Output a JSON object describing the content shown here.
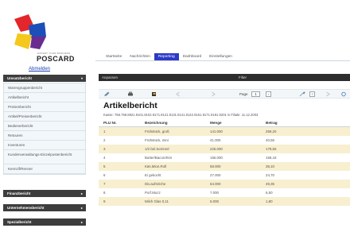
{
  "app": {
    "brand": "POSCARD",
    "tagline": "EXPERT YOUR BUSINESS",
    "logout": "Abmelden"
  },
  "colors": {
    "accent": "#2c3ac7",
    "sidebar_header": "#3d3d3d",
    "row_highlight": "#f7efcf",
    "logo_red": "#e3262b",
    "logo_blue": "#1d4fb8",
    "logo_yellow": "#f4c81c",
    "logo_purple": "#6a2c91"
  },
  "sidebar": {
    "sections": [
      {
        "label": "Umsatzbericht",
        "expanded": true
      },
      {
        "label": "Finanzbericht",
        "expanded": false
      },
      {
        "label": "Unternehmensbericht",
        "expanded": false
      },
      {
        "label": "Spezialbericht",
        "expanded": false
      }
    ],
    "items": [
      "Warengruppenbericht",
      "Artikelbericht",
      "Preisenbericht",
      "Artikel/Preisenbericht",
      "Bedienerbericht",
      "Retouren",
      "Inventuren",
      "Kundenverwaltungs-Einzelpostenbericht",
      "Kennzif/Renner"
    ]
  },
  "tabs": [
    {
      "label": "Startseite",
      "active": false
    },
    {
      "label": "Nachrichten",
      "active": false
    },
    {
      "label": "Reporting",
      "active": true
    },
    {
      "label": "Dashboard",
      "active": false
    },
    {
      "label": "Einstellungen",
      "active": false
    }
  ],
  "panel": {
    "col_left": "Anpassen",
    "col_right": "Filter"
  },
  "toolbar": {
    "icons": [
      "edit-icon",
      "print-icon",
      "export-icon",
      "prev-icon",
      "next-icon",
      "settings-icon",
      "help-icon",
      "refresh-icon"
    ],
    "page_label": "Page",
    "page_value": "1",
    "page_help": "?"
  },
  "report": {
    "title": "Artikelbericht",
    "subline": "Kasse: 758.759.8921.9101.9102.9171.9121.9131.9141.9142.9151.9171.9181.9201  in Filiale:  11.12.2003"
  },
  "table": {
    "headers": [
      "PLU Nr.",
      "Bezeichnung",
      "Menge",
      "Betrag"
    ],
    "rows": [
      [
        "1",
        "Frühstück, groß",
        "141.000",
        "259,20"
      ],
      [
        "2",
        "Frühstück, mini",
        "41.000",
        "40,55"
      ],
      [
        "3",
        "1/2 bel.Semmel",
        "225.000",
        "179,55"
      ],
      [
        "4",
        "Butter/Bacon/Kim",
        "155.000",
        "159,43"
      ],
      [
        "5",
        "Käs.Mion.Roll",
        "58.000",
        "38,10"
      ],
      [
        "6",
        "Ei gekocht",
        "27.000",
        "24,70"
      ],
      [
        "7",
        "Div.aufstriche",
        "54.000",
        "49,35"
      ],
      [
        "8",
        "Porf.Muzz",
        "7.000",
        "6,50"
      ],
      [
        "9",
        "Milch Glas 0,11",
        "5.000",
        "1,80"
      ]
    ]
  }
}
